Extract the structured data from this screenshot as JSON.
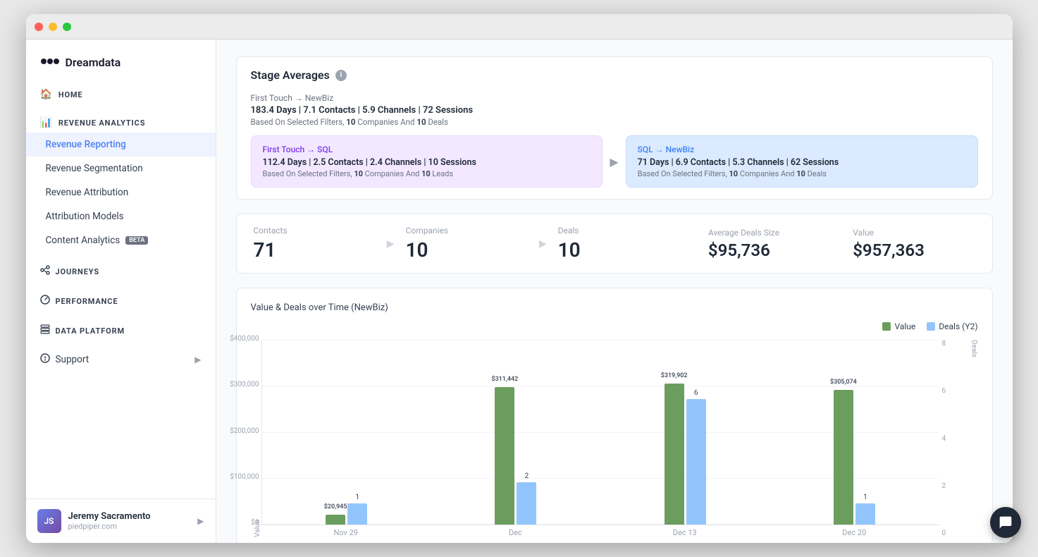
{
  "window": {
    "title": "Dreamdata"
  },
  "sidebar": {
    "logo": "Dreamdata",
    "sections": [
      {
        "id": "home",
        "label": "HOME",
        "icon": "🏠",
        "items": []
      },
      {
        "id": "revenue-analytics",
        "label": "REVENUE ANALYTICS",
        "icon": "📊",
        "items": [
          {
            "id": "revenue-reporting",
            "label": "Revenue Reporting",
            "active": true
          },
          {
            "id": "revenue-segmentation",
            "label": "Revenue Segmentation",
            "active": false
          },
          {
            "id": "revenue-attribution",
            "label": "Revenue Attribution",
            "active": false
          },
          {
            "id": "attribution-models",
            "label": "Attribution Models",
            "active": false
          },
          {
            "id": "content-analytics",
            "label": "Content Analytics",
            "active": false,
            "badge": "Beta"
          }
        ]
      },
      {
        "id": "journeys",
        "label": "JOURNEYS",
        "icon": "🔗",
        "items": []
      },
      {
        "id": "performance",
        "label": "PERFORMANCE",
        "icon": "⚡",
        "items": []
      },
      {
        "id": "data-platform",
        "label": "DATA PLATFORM",
        "icon": "🗄️",
        "items": []
      }
    ],
    "support": {
      "label": "Support",
      "icon": "❓"
    },
    "user": {
      "name": "Jeremy Sacramento",
      "company": "piedpiper.com"
    }
  },
  "main": {
    "stage_averages": {
      "title": "Stage Averages",
      "top_row": {
        "label": "First Touch → NewBiz",
        "stats": "183.4 Days | 7.1 Contacts | 5.9 Channels | 72 Sessions",
        "note_prefix": "Based On Selected Filters,",
        "companies": "10",
        "deals": "10",
        "note_suffix": "Companies And",
        "note_end": "Deals"
      },
      "card_left": {
        "label": "First Touch → SQL",
        "stats": "112.4 Days | 2.5 Contacts | 2.4 Channels | 10 Sessions",
        "note_prefix": "Based On Selected Filters,",
        "companies": "10",
        "leads": "10",
        "note_suffix": "Companies And",
        "note_end": "Leads"
      },
      "card_right": {
        "label": "SQL → NewBiz",
        "stats": "71 Days | 6.9 Contacts | 5.3 Channels | 62 Sessions",
        "note_prefix": "Based On Selected Filters,",
        "companies": "10",
        "deals": "10",
        "note_suffix": "Companies And",
        "note_end": "Deals"
      }
    },
    "metrics": {
      "contacts": {
        "label": "Contacts",
        "value": "71"
      },
      "companies": {
        "label": "Companies",
        "value": "10"
      },
      "deals": {
        "label": "Deals",
        "value": "10"
      },
      "avg_deal_size": {
        "label": "Average Deals Size",
        "value": "$95,736"
      },
      "value": {
        "label": "Value",
        "value": "$957,363"
      }
    },
    "chart": {
      "title": "Value & Deals over Time (NewBiz)",
      "legend": {
        "value_label": "Value",
        "deals_label": "Deals (Y2)"
      },
      "y_label": "Value",
      "y_right_label": "Deals",
      "y_ticks": [
        "$400,000",
        "$300,000",
        "$200,000",
        "$100,000",
        "$0"
      ],
      "y_right_ticks": [
        "8",
        "6",
        "4",
        "2",
        "0"
      ],
      "bars": [
        {
          "x": "Nov 29",
          "value_label": "$20,945",
          "value_height": 5.2,
          "deals_label": "1",
          "deals_height": 12.5
        },
        {
          "x": "Dec",
          "value_label": "$311,442",
          "value_height": 77.9,
          "deals_label": "2",
          "deals_height": 25
        },
        {
          "x": "Dec 13",
          "value_label": "$319,902",
          "value_height": 80.0,
          "deals_label": "6",
          "deals_height": 75
        },
        {
          "x": "Dec 20",
          "value_label": "$305,074",
          "value_height": 76.3,
          "deals_label": "1",
          "deals_height": 12.5
        }
      ]
    }
  }
}
